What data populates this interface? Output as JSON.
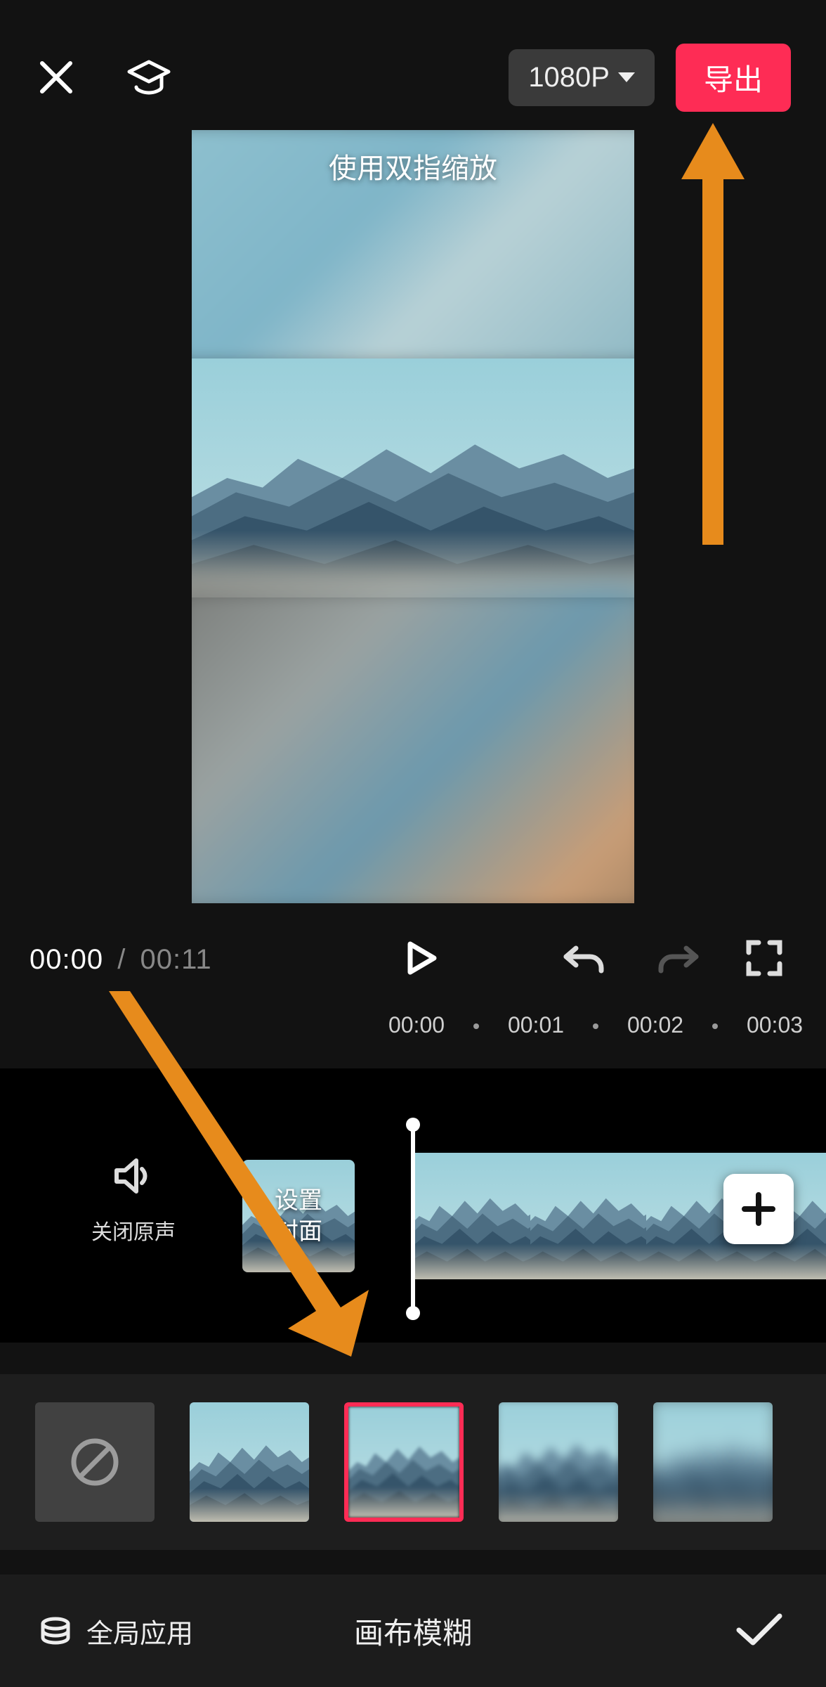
{
  "topbar": {
    "resolution_label": "1080P",
    "export_label": "导出"
  },
  "preview": {
    "hint_text": "使用双指缩放"
  },
  "playback": {
    "current_time": "00:00",
    "separator": "/",
    "duration": "00:11"
  },
  "ruler": {
    "ticks": [
      "00:00",
      "00:01",
      "00:02",
      "00:03"
    ]
  },
  "timeline": {
    "mute_label": "关闭原声",
    "cover_label": "设置\n封面"
  },
  "blur_panel": {
    "options": [
      {
        "id": "none"
      },
      {
        "id": "clear"
      },
      {
        "id": "blur1",
        "selected": true
      },
      {
        "id": "blur2"
      },
      {
        "id": "blur3"
      }
    ]
  },
  "bottombar": {
    "apply_all_label": "全局应用",
    "panel_title": "画布模糊"
  },
  "colors": {
    "accent": "#fe2c55",
    "annotation": "#e78b1c"
  }
}
